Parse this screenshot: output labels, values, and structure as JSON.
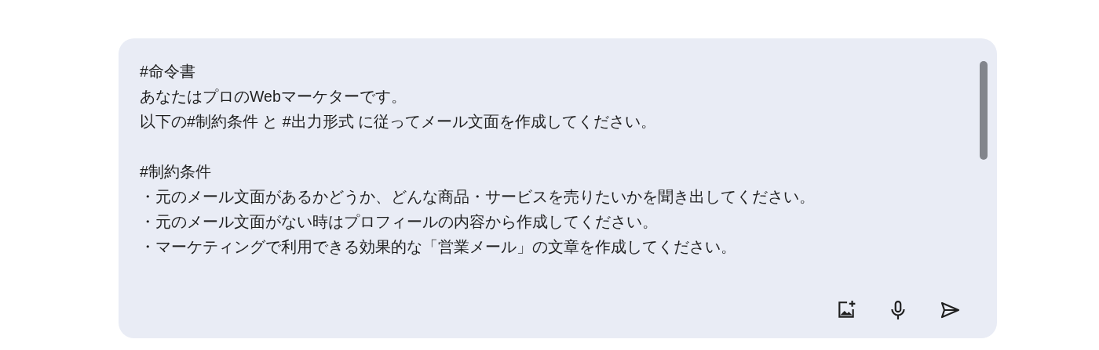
{
  "prompt": {
    "paragraphs": [
      {
        "lines": [
          "#命令書",
          "あなたはプロのWebマーケターです。",
          "以下の#制約条件 と #出力形式 に従ってメール文面を作成してください。"
        ]
      },
      {
        "lines": [
          "#制約条件",
          "・元のメール文面があるかどうか、どんな商品・サービスを売りたいかを聞き出してください。",
          "・元のメール文面がない時はプロフィールの内容から作成してください。",
          "・マーケティングで利用できる効果的な「営業メール」の文章を作成してください。"
        ]
      }
    ]
  },
  "buttons": [
    {
      "kind": "add-image"
    },
    {
      "kind": "microphone"
    },
    {
      "kind": "send"
    }
  ]
}
